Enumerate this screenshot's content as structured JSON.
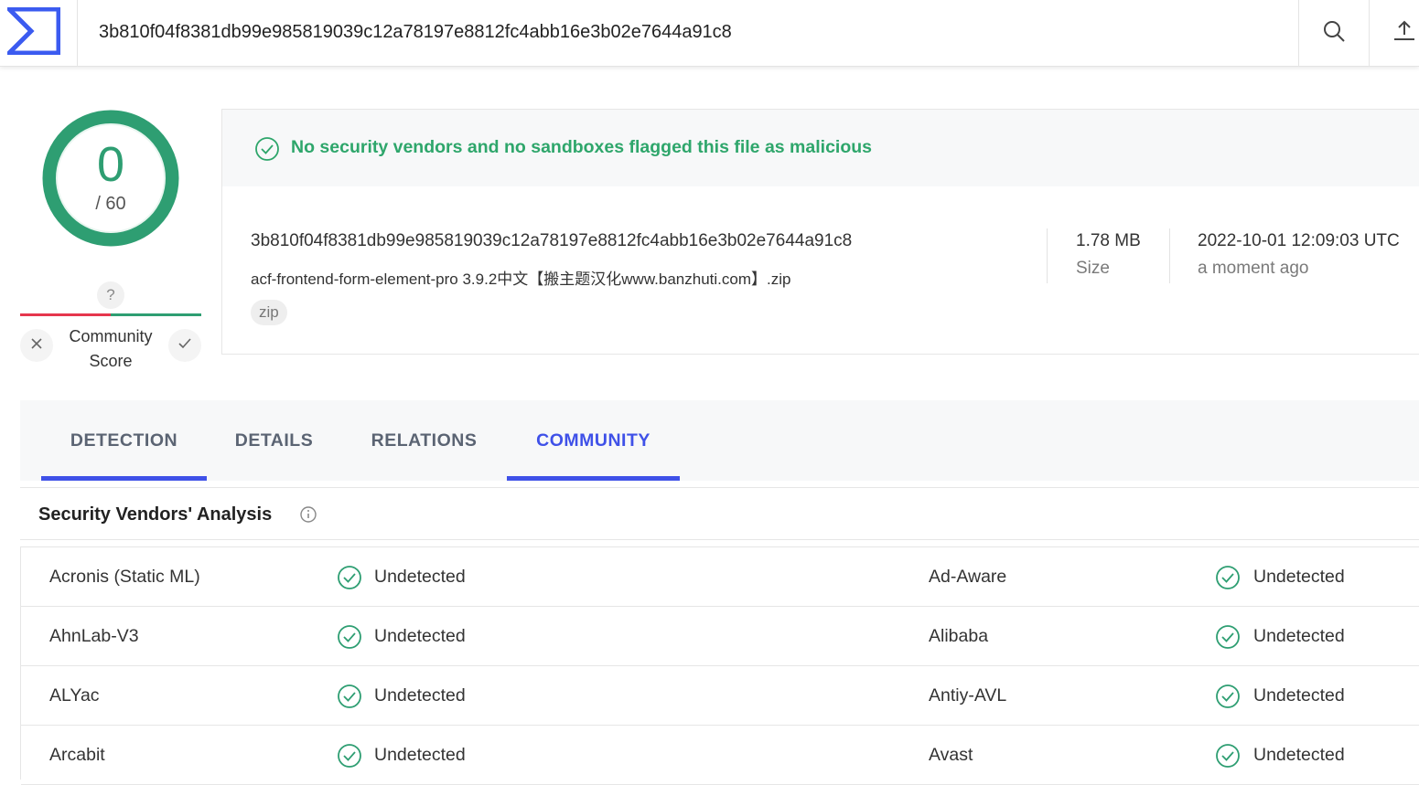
{
  "search": {
    "value": "3b810f04f8381db99e985819039c12a78197e8812fc4abb16e3b02e7644a91c8"
  },
  "icons": {
    "logo": "virustotal-sigma-logo",
    "search": "search-icon",
    "upload": "upload-icon",
    "check": "check-circle-icon",
    "info": "info-icon",
    "close": "close-icon",
    "vote_up": "check-icon"
  },
  "colors": {
    "accent": "#3f51e8",
    "clean": "#2e9e72",
    "malicious": "#e5364d"
  },
  "score": {
    "detections": "0",
    "total": "/ 60",
    "community_score": "?",
    "community_label_line1": "Community",
    "community_label_line2": "Score"
  },
  "summary": {
    "banner": "No security vendors and no sandboxes flagged this file as malicious",
    "hash": "3b810f04f8381db99e985819039c12a78197e8812fc4abb16e3b02e7644a91c8",
    "filename": "acf-frontend-form-element-pro 3.9.2中文【搬主题汉化www.banzhuti.com】.zip",
    "tag": "zip",
    "size_value": "1.78 MB",
    "size_label": "Size",
    "date_value": "2022-10-01 12:09:03 UTC",
    "date_label": "a moment ago"
  },
  "tabs": [
    {
      "label": "DETECTION"
    },
    {
      "label": "DETAILS"
    },
    {
      "label": "RELATIONS"
    },
    {
      "label": "COMMUNITY"
    }
  ],
  "vendors": {
    "title": "Security Vendors' Analysis",
    "rows": [
      {
        "left_name": "Acronis (Static ML)",
        "left_result": "Undetected",
        "right_name": "Ad-Aware",
        "right_result": "Undetected"
      },
      {
        "left_name": "AhnLab-V3",
        "left_result": "Undetected",
        "right_name": "Alibaba",
        "right_result": "Undetected"
      },
      {
        "left_name": "ALYac",
        "left_result": "Undetected",
        "right_name": "Antiy-AVL",
        "right_result": "Undetected"
      },
      {
        "left_name": "Arcabit",
        "left_result": "Undetected",
        "right_name": "Avast",
        "right_result": "Undetected"
      }
    ]
  }
}
